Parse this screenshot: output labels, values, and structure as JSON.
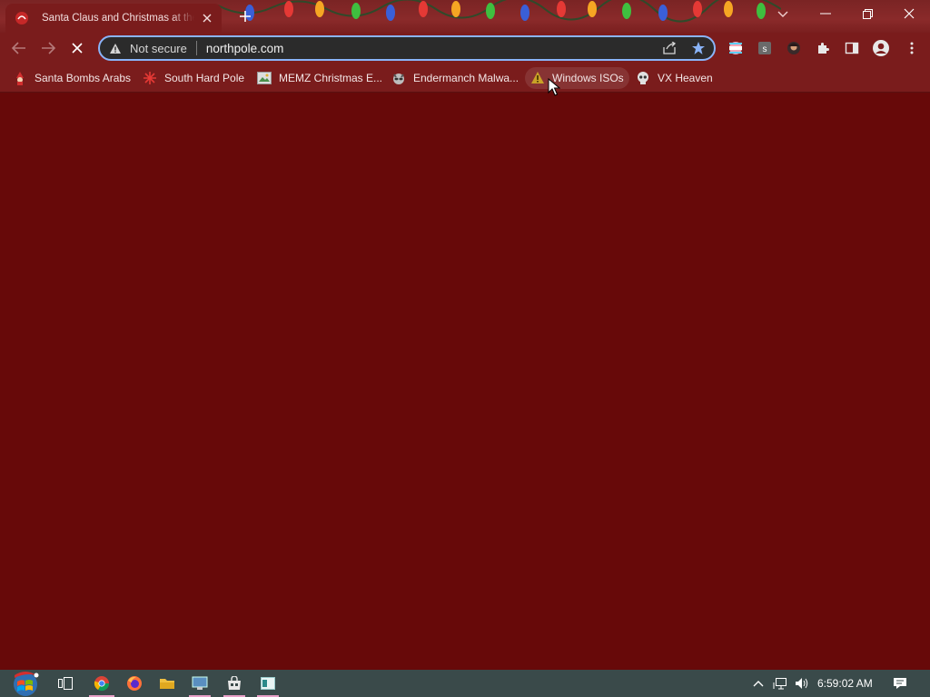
{
  "browser": {
    "tab": {
      "title": "Santa Claus and Christmas at the North Pole"
    },
    "omnibox": {
      "security_label": "Not secure",
      "url": "northpole.com"
    },
    "extensions": [
      "pride-flag-extension",
      "s-extension",
      "avatar-extension",
      "puzzle-extensions-icon"
    ]
  },
  "bookmarks": [
    {
      "label": "Santa Bombs Arabs",
      "icon": "santa-icon"
    },
    {
      "label": "South Hard Pole",
      "icon": "snowflake-icon"
    },
    {
      "label": "MEMZ Christmas E...",
      "icon": "image-icon"
    },
    {
      "label": "Endermanch Malwa...",
      "icon": "raccoon-icon"
    },
    {
      "label": "Windows ISOs",
      "icon": "warning-folder-icon"
    },
    {
      "label": "VX Heaven",
      "icon": "skull-icon"
    }
  ],
  "taskbar": {
    "clock": "6:59:02 AM",
    "apps": [
      "start-button",
      "task-view",
      "chrome",
      "firefox",
      "file-explorer",
      "remote-desktop",
      "store",
      "sheet-app"
    ]
  },
  "colors": {
    "page_background": "#670909",
    "frame": "#7a1c1c",
    "accent": "#8ab4f8",
    "star": "#8ab4f8"
  }
}
